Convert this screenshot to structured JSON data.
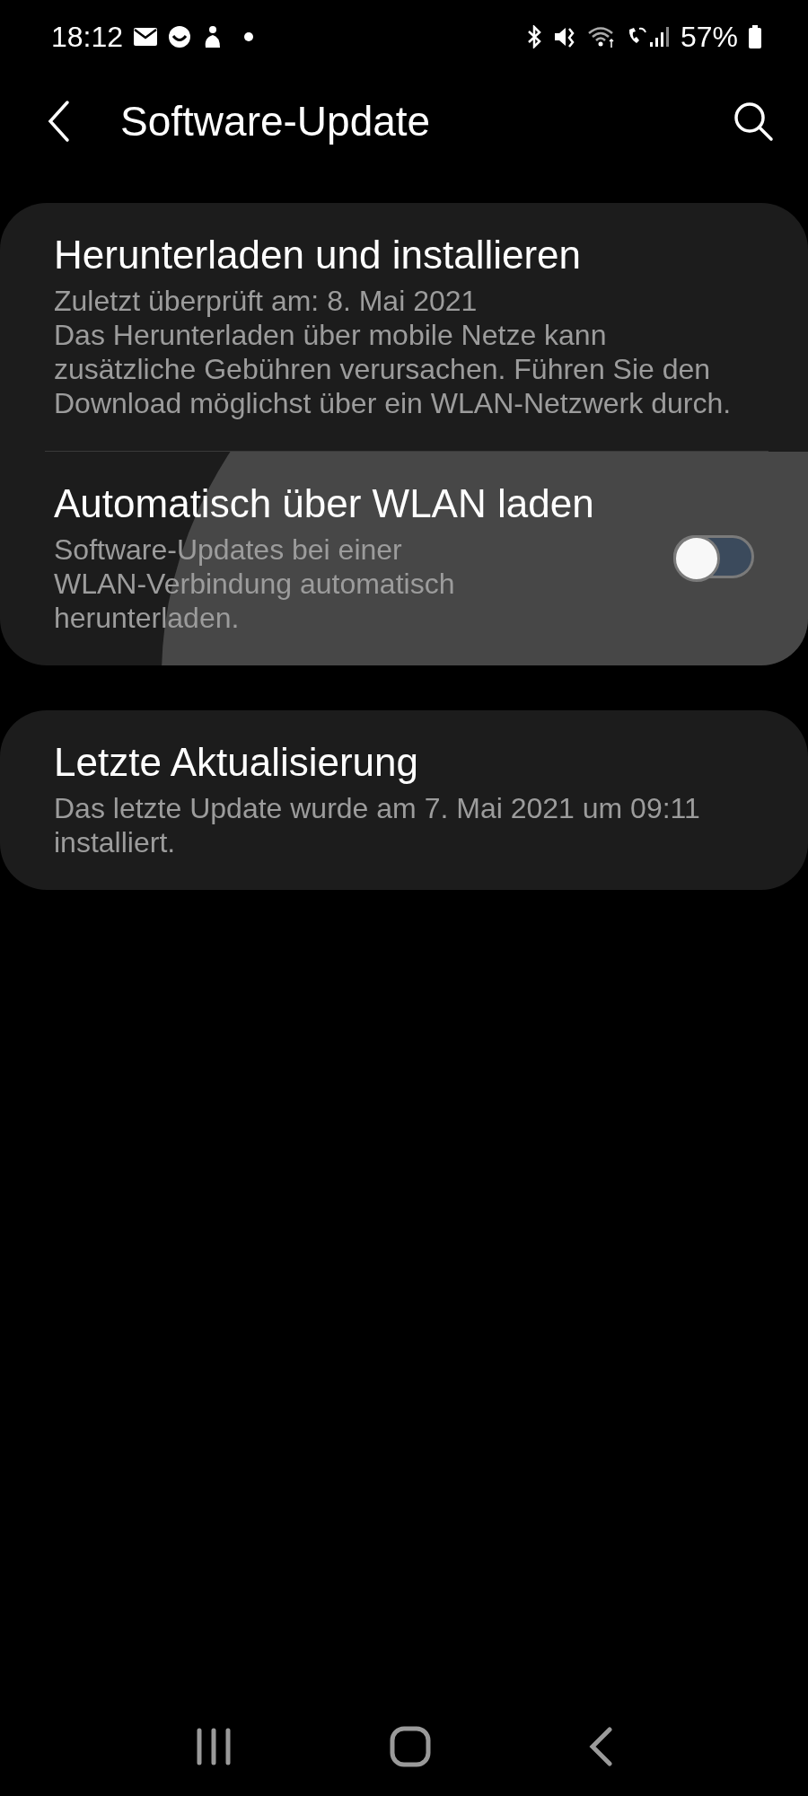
{
  "status_bar": {
    "time": "18:12",
    "battery": "57%"
  },
  "header": {
    "title": "Software-Update"
  },
  "cards": [
    {
      "items": [
        {
          "kind": "info",
          "title": "Herunterladen und installieren",
          "lines": [
            "Zuletzt überprüft am: 8. Mai 2021",
            "Das Herunterladen über mobile Netze kann zusätzliche Gebühren verursachen. Führen Sie den Download möglichst über ein WLAN-Netzwerk durch."
          ],
          "pressed": false
        },
        {
          "kind": "switch",
          "title": "Automatisch über WLAN laden",
          "lines": [
            "Software-Updates bei einer WLAN-Verbindung automatisch herunterladen."
          ],
          "on": false,
          "pressed": true
        }
      ]
    },
    {
      "items": [
        {
          "kind": "info",
          "title": "Letzte Aktualisierung",
          "lines": [
            "Das letzte Update wurde am 7. Mai 2021 um 09:11 installiert."
          ],
          "pressed": false
        }
      ]
    }
  ]
}
